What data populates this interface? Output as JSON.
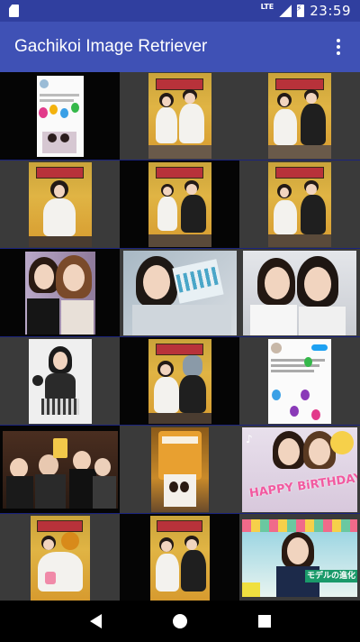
{
  "status_bar": {
    "network": "LTE",
    "time": "23:59"
  },
  "app_bar": {
    "title": "Gachikoi Image Retriever"
  },
  "images": [
    {
      "kind": "screenshot-tweet"
    },
    {
      "kind": "poster-pair"
    },
    {
      "kind": "poster-pair-heart"
    },
    {
      "kind": "poster-single"
    },
    {
      "kind": "poster-pair-wide"
    },
    {
      "kind": "poster-pair"
    },
    {
      "kind": "selfie-dark"
    },
    {
      "kind": "selfie-light"
    },
    {
      "kind": "selfie-pair"
    },
    {
      "kind": "single-girl"
    },
    {
      "kind": "poster-mask"
    },
    {
      "kind": "screenshot-tweet"
    },
    {
      "kind": "group-restaurant"
    },
    {
      "kind": "beer-photo"
    },
    {
      "kind": "birthday-pair"
    },
    {
      "kind": "poster-lion"
    },
    {
      "kind": "poster-pair"
    },
    {
      "kind": "tv-capture"
    }
  ],
  "birthday_text": "HAPPY BiRTHDAY",
  "tv_caption": "モデルの進化"
}
